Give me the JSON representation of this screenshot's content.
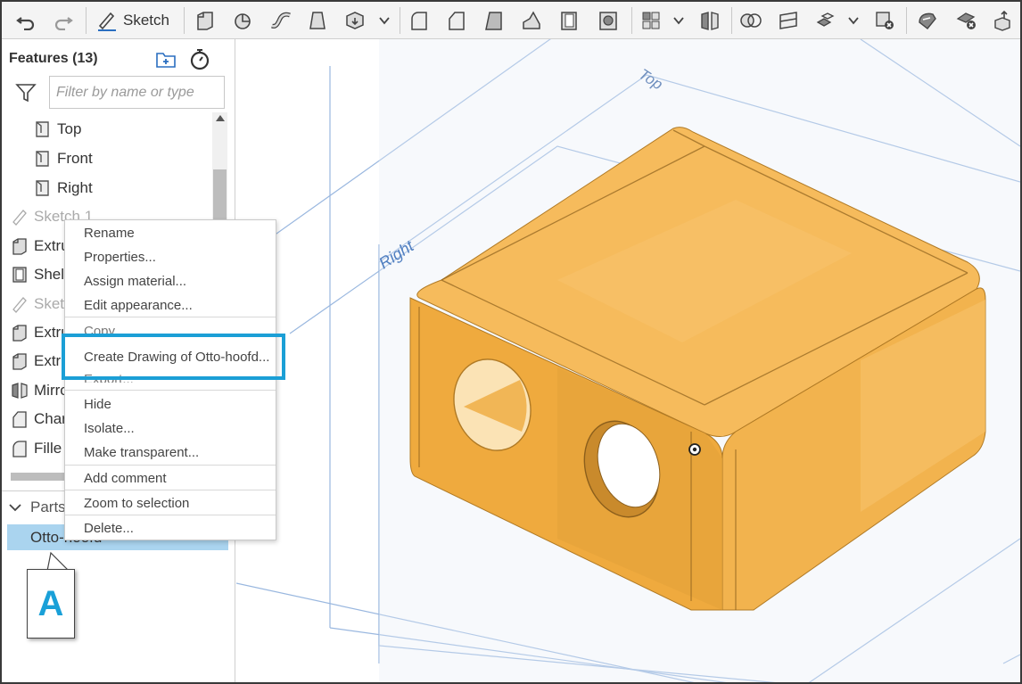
{
  "toolbar": {
    "sketch_label": "Sketch",
    "icons": [
      "undo-icon",
      "redo-icon",
      "sketch-icon",
      "extrude-icon",
      "revolve-icon",
      "sweep-icon",
      "loft-icon",
      "thicken-icon",
      "fillet-icon",
      "chamfer-icon",
      "draft-icon",
      "rib-icon",
      "shell-icon",
      "hole-icon",
      "pattern-icon",
      "mirror-icon",
      "boolean-icon",
      "split-icon",
      "transform-icon",
      "delete-part-icon",
      "modify-fillet-icon",
      "delete-face-icon",
      "export-icon"
    ]
  },
  "features": {
    "title": "Features (13)",
    "filter_placeholder": "Filter by name or type",
    "items": [
      {
        "label": "Top",
        "icon": "plane-icon"
      },
      {
        "label": "Front",
        "icon": "plane-icon"
      },
      {
        "label": "Right",
        "icon": "plane-icon"
      },
      {
        "label": "Sketch 1",
        "icon": "sketch-icon"
      },
      {
        "label": "Extru",
        "icon": "extrude-icon"
      },
      {
        "label": "Shel",
        "icon": "shell-icon"
      },
      {
        "label": "Sketc",
        "icon": "sketch-icon"
      },
      {
        "label": "Extru",
        "icon": "extrude-icon"
      },
      {
        "label": "Extru",
        "icon": "extrude-icon"
      },
      {
        "label": "Mirro",
        "icon": "mirror-icon"
      },
      {
        "label": "Char",
        "icon": "chamfer-icon"
      },
      {
        "label": "Fille",
        "icon": "fillet-icon"
      }
    ]
  },
  "parts": {
    "label": "Parts",
    "selected": "Otto-hoofd"
  },
  "context_menu": {
    "items": [
      "Rename",
      "Properties...",
      "Assign material...",
      "Edit appearance...",
      "Copy",
      "Create Drawing of Otto-hoofd...",
      "Export...",
      "Hide",
      "Isolate...",
      "Make transparent...",
      "Add comment",
      "Zoom to selection",
      "Delete..."
    ]
  },
  "viewport": {
    "plane_top": "Top",
    "plane_right": "Right",
    "part_color": "#f4b04a",
    "plane_color": "#4f7ec0"
  },
  "callout": {
    "letter": "A",
    "color": "#1aa0d8"
  },
  "colors": {
    "highlight": "#1b9fd6",
    "selection": "#aad4ef"
  }
}
